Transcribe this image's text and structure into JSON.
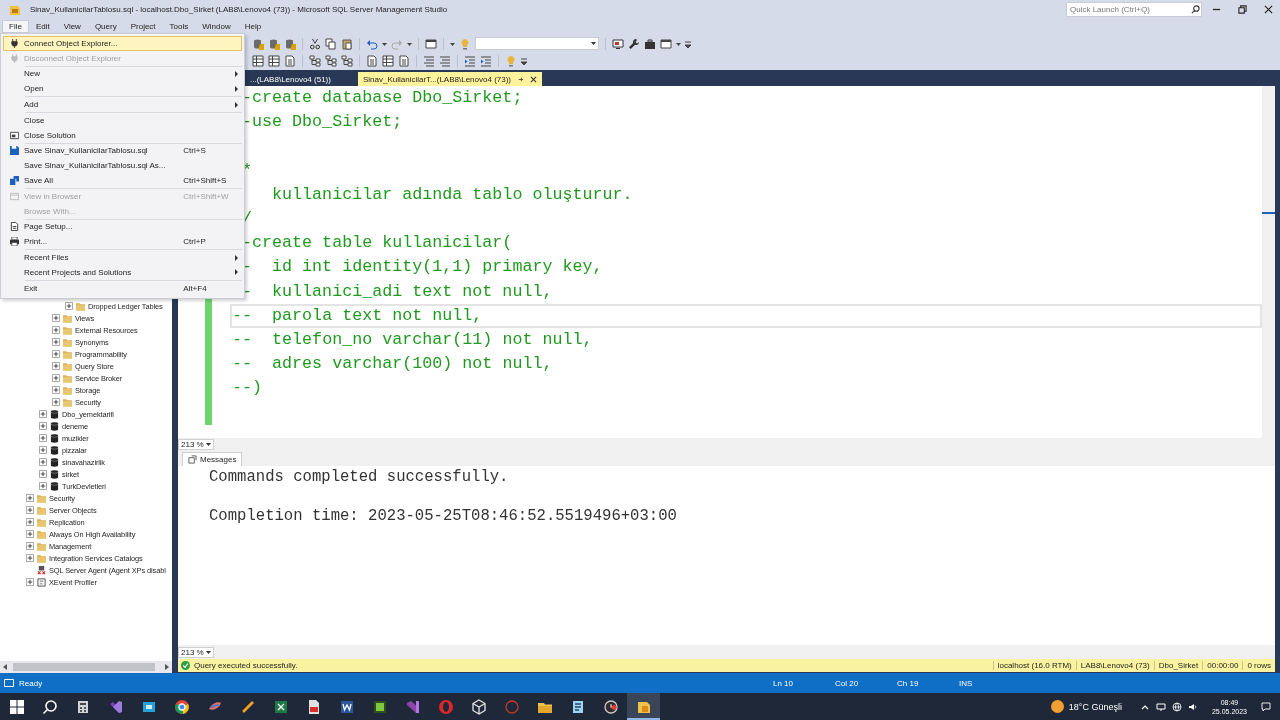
{
  "window": {
    "title": "Sinav_KullanicilarTablosu.sql - localhost.Dbo_Sirket (LAB8\\Lenovo4 (73)) - Microsoft SQL Server Management Studio",
    "quick_launch": {
      "placeholder": "Quick Launch (Ctrl+Q)"
    }
  },
  "menu_bar": [
    {
      "label": "File",
      "selected": true
    },
    {
      "label": "Edit",
      "selected": false
    },
    {
      "label": "View",
      "selected": false
    },
    {
      "label": "Query",
      "selected": false
    },
    {
      "label": "Project",
      "selected": false
    },
    {
      "label": "Tools",
      "selected": false
    },
    {
      "label": "Window",
      "selected": false
    },
    {
      "label": "Help",
      "selected": false
    }
  ],
  "file_menu": [
    {
      "kind": "plug",
      "label": "Connect Object Explorer...",
      "highlighted": true,
      "disabled": false,
      "submenu": false
    },
    {
      "kind": "plug",
      "label": "Disconnect Object Explorer",
      "highlighted": false,
      "disabled": true,
      "submenu": false
    },
    {
      "kind": "separator"
    },
    {
      "kind": "plain",
      "label": "New",
      "highlighted": false,
      "disabled": false,
      "submenu": true
    },
    {
      "kind": "plain",
      "label": "Open",
      "highlighted": false,
      "disabled": false,
      "submenu": true
    },
    {
      "kind": "separator"
    },
    {
      "kind": "plain",
      "label": "Add",
      "highlighted": false,
      "disabled": false,
      "submenu": true
    },
    {
      "kind": "separator"
    },
    {
      "kind": "plain",
      "label": "Close",
      "highlighted": false,
      "disabled": false,
      "submenu": false
    },
    {
      "kind": "window",
      "label": "Close Solution",
      "highlighted": false,
      "disabled": false,
      "submenu": false
    },
    {
      "kind": "separator"
    },
    {
      "kind": "save",
      "label": "Save Sinav_KullanicilarTablosu.sql",
      "shortcut": "Ctrl+S",
      "highlighted": false,
      "disabled": false,
      "submenu": false
    },
    {
      "kind": "plain",
      "label": "Save Sinav_KullanicilarTablosu.sql As...",
      "highlighted": false,
      "disabled": false,
      "submenu": false
    },
    {
      "kind": "save-all",
      "label": "Save All",
      "shortcut": "Ctrl+Shift+S",
      "highlighted": false,
      "disabled": false,
      "submenu": false
    },
    {
      "kind": "separator"
    },
    {
      "kind": "browser",
      "label": "View in Browser",
      "shortcut": "Ctrl+Shift+W",
      "highlighted": false,
      "disabled": true,
      "submenu": false
    },
    {
      "kind": "plain",
      "label": "Browse With...",
      "highlighted": false,
      "disabled": true,
      "submenu": false
    },
    {
      "kind": "separator"
    },
    {
      "kind": "page",
      "label": "Page Setup...",
      "highlighted": false,
      "disabled": false,
      "submenu": false
    },
    {
      "kind": "printer",
      "label": "Print...",
      "shortcut": "Ctrl+P",
      "highlighted": false,
      "disabled": false,
      "submenu": false
    },
    {
      "kind": "separator"
    },
    {
      "kind": "plain",
      "label": "Recent Files",
      "highlighted": false,
      "disabled": false,
      "submenu": true
    },
    {
      "kind": "plain",
      "label": "Recent Projects and Solutions",
      "highlighted": false,
      "disabled": false,
      "submenu": true
    },
    {
      "kind": "separator"
    },
    {
      "kind": "plain",
      "label": "Exit",
      "shortcut": "Alt+F4",
      "highlighted": false,
      "disabled": false,
      "submenu": false
    }
  ],
  "object_explorer": {
    "tree": [
      {
        "children": [
          {
            "children": [
              {
                "children": [
                  {
                    "children": [
                      {
                        "label": "Dropped Ledger Tables",
                        "kind": "folder",
                        "expanded": false
                      }
                    ]
                  },
                  {
                    "label": "Views",
                    "kind": "folder",
                    "expanded": false
                  },
                  {
                    "label": "External Resources",
                    "kind": "folder",
                    "expanded": false
                  },
                  {
                    "label": "Synonyms",
                    "kind": "folder",
                    "expanded": false
                  },
                  {
                    "label": "Programmability",
                    "kind": "folder",
                    "expanded": false
                  },
                  {
                    "label": "Query Store",
                    "kind": "folder",
                    "expanded": false
                  },
                  {
                    "label": "Service Broker",
                    "kind": "folder",
                    "expanded": false
                  },
                  {
                    "label": "Storage",
                    "kind": "folder",
                    "expanded": false
                  },
                  {
                    "label": "Security",
                    "kind": "folder",
                    "expanded": false
                  }
                ]
              },
              {
                "label": "Dbo_yemektarifi",
                "kind": "database",
                "expanded": false
              },
              {
                "label": "deneme",
                "kind": "database",
                "expanded": false
              },
              {
                "label": "muzikler",
                "kind": "database",
                "expanded": false
              },
              {
                "label": "pizzalar",
                "kind": "database",
                "expanded": false
              },
              {
                "label": "sinavahazirlik",
                "kind": "database",
                "expanded": false
              },
              {
                "label": "sirket",
                "kind": "database",
                "expanded": false
              },
              {
                "label": "TurkDevletleri",
                "kind": "database",
                "expanded": false
              }
            ]
          },
          {
            "label": "Security",
            "kind": "folder",
            "expanded": false
          },
          {
            "label": "Server Objects",
            "kind": "folder",
            "expanded": false
          },
          {
            "label": "Replication",
            "kind": "folder",
            "expanded": false
          },
          {
            "label": "Always On High Availability",
            "kind": "folder",
            "expanded": false
          },
          {
            "label": "Management",
            "kind": "folder",
            "expanded": false
          },
          {
            "label": "Integration Services Catalogs",
            "kind": "folder",
            "expanded": false
          },
          {
            "label": "SQL Server Agent (Agent XPs disabl",
            "kind": "agent"
          },
          {
            "label": "XEvent Profiler",
            "kind": "profiler",
            "expanded": false
          }
        ]
      }
    ]
  },
  "document_tabs": [
    {
      "label": "...(LAB8\\Lenovo4 (51))",
      "selected": false
    },
    {
      "label": "Sinav_KullanicilarT...(LAB8\\Lenovo4 (73))",
      "selected": true
    }
  ],
  "editor": {
    "lines": [
      {
        "kind": "clipped",
        "text": "-create database Dbo_Sirket;",
        "current": false
      },
      {
        "kind": "clipped",
        "text": "-use Dbo_Sirket;",
        "current": false
      },
      {
        "kind": "blank"
      },
      {
        "kind": "clipped",
        "text": "*",
        "current": false
      },
      {
        "kind": "clipped",
        "text": "   kullanicilar adında tablo oluşturur.",
        "current": false
      },
      {
        "kind": "clipped",
        "text": "/",
        "current": false
      },
      {
        "kind": "clipped",
        "text": "-create table kullanicilar(",
        "current": false
      },
      {
        "kind": "clipped",
        "text": "-  id int identity(1,1) primary key,",
        "current": false
      },
      {
        "kind": "clipped",
        "text": "-  kullanici_adi text not null,",
        "current": false
      },
      {
        "kind": "code",
        "text": "--  parola text not null,",
        "current": true
      },
      {
        "kind": "code",
        "text": "--  telefon_no varchar(11) not null,",
        "current": false
      },
      {
        "kind": "code",
        "text": "--  adres varchar(100) not null,",
        "current": false
      },
      {
        "kind": "code",
        "text": "--)",
        "current": false
      }
    ],
    "zoom": "213 %"
  },
  "results": {
    "tabs": [
      {
        "label": "Messages",
        "selected": true
      }
    ],
    "messages": [
      "Commands completed successfully.",
      "Completion time: 2023-05-25T08:46:52.5519496+03:00"
    ],
    "zoom": "213 %"
  },
  "query_status": {
    "message": "Query executed successfully.",
    "fields": [
      "localhost (16.0 RTM)",
      "LAB8\\Lenovo4 (73)",
      "Dbo_Sirket",
      "00:00:00",
      "0 rows"
    ]
  },
  "status_bar": {
    "state": "Ready",
    "items": [
      "Ln 10",
      "Col 20",
      "Ch 19",
      "INS"
    ]
  },
  "taskbar": {
    "weather": "18°C Güneşli",
    "time": "08:49",
    "date": "25.05.2023"
  }
}
